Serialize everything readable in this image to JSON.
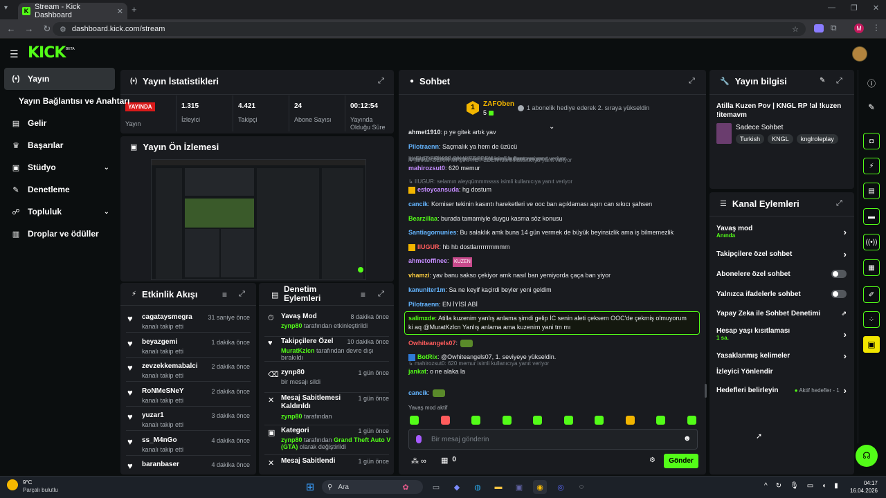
{
  "browser": {
    "tab_title": "Stream - Kick Dashboard",
    "url": "dashboard.kick.com/stream",
    "profile_initial": "M"
  },
  "brand": {
    "logo": "KICK",
    "badge": "BETA",
    "accent": "#53fc18"
  },
  "sidebar": {
    "items": [
      {
        "label": "Yayın",
        "icon": "broadcast-icon",
        "active": true
      },
      {
        "label": "Yayın Bağlantısı ve Anahtarı",
        "icon": "",
        "active": false
      },
      {
        "label": "Gelir",
        "icon": "revenue-icon",
        "active": false
      },
      {
        "label": "Başarılar",
        "icon": "trophy-icon",
        "active": false
      },
      {
        "label": "Stüdyo",
        "icon": "studio-icon",
        "active": false,
        "expandable": true
      },
      {
        "label": "Denetleme",
        "icon": "wrench-icon",
        "active": false
      },
      {
        "label": "Topluluk",
        "icon": "community-icon",
        "active": false,
        "expandable": true
      },
      {
        "label": "Droplar ve ödüller",
        "icon": "drops-icon",
        "active": false
      }
    ]
  },
  "stats": {
    "title": "Yayın İstatistikleri",
    "live_badge": "YAYINDA",
    "live_label": "Yayın",
    "items": [
      {
        "value": "1.315",
        "label": "İzleyici"
      },
      {
        "value": "4.421",
        "label": "Takipçi"
      },
      {
        "value": "24",
        "label": "Abone Sayısı"
      },
      {
        "value": "00:12:54",
        "label": "Yayında Olduğu Süre"
      }
    ]
  },
  "preview": {
    "title": "Yayın Ön İzlemesi"
  },
  "activity": {
    "title": "Etkinlik Akışı",
    "items": [
      {
        "user": "cagataysmegra",
        "action": "kanalı takip etti",
        "time": "31 saniye önce"
      },
      {
        "user": "beyazgemi",
        "action": "kanalı takip etti",
        "time": "1 dakika önce"
      },
      {
        "user": "zevzekkemabalci",
        "action": "kanalı takip etti",
        "time": "2 dakika önce"
      },
      {
        "user": "RoNMeSNeY",
        "action": "kanalı takip etti",
        "time": "2 dakika önce"
      },
      {
        "user": "yuzar1",
        "action": "kanalı takip etti",
        "time": "3 dakika önce"
      },
      {
        "user": "ss_M4nGo",
        "action": "kanalı takip etti",
        "time": "4 dakika önce"
      },
      {
        "user": "baranbaser",
        "action": "",
        "time": "4 dakika önce"
      }
    ]
  },
  "moderation": {
    "title": "Denetim Eylemleri",
    "items": [
      {
        "title": "Yavaş Mod",
        "user": "zynp80",
        "detail": "tarafından etkinleştirildi",
        "time": "8 dakika önce"
      },
      {
        "title": "Takipçilere Özel",
        "user": "MuratKzlcn",
        "detail": "tarafından devre dışı bırakıldı",
        "time": "10 dakika önce"
      },
      {
        "title": "zynp80",
        "user": "",
        "detail": "bir mesajı sildi",
        "time": "1 gün önce"
      },
      {
        "title": "Mesaj Sabitlemesi Kaldırıldı",
        "user": "zynp80",
        "detail": "tarafından",
        "time": "1 gün önce"
      },
      {
        "title": "Kategori",
        "user": "zynp80",
        "detail": "tarafından",
        "extra": "Grand Theft Auto V (GTA)",
        "extra2": "olarak değiştirildi",
        "time": "1 gün önce"
      },
      {
        "title": "Mesaj Sabitlendi",
        "user": "",
        "detail": "",
        "time": "1 gün önce"
      }
    ]
  },
  "chat": {
    "title": "Sohbet",
    "pinned_user": "ZAFOben",
    "pinned_count": "5",
    "pinned_text": "1 abonelik hediye ederek 2. sıraya yükseldin",
    "messages": [
      {
        "user": "ahmet1910",
        "text": ": p ye gitek artık yav",
        "color": "#e8eaed"
      },
      {
        "user": "Pilotraenn",
        "text": ": Saçmalık ya hem de üzücü",
        "color": "#64b5ff"
      },
      {
        "reply": "jankat: DERİN Mİ ŞİKAYET EDEN isimli kullanıcıya yanıt veriyor",
        "user": "mahirozsut0",
        "text": ": 620 memur",
        "color": "#c58dff"
      },
      {
        "reply": "IIUGUR: selamın aleyqümmmssss isimli kullanıcıya yanıt veriyor",
        "user": "estoycansuda",
        "text": ": hg dostum",
        "color": "#c58dff"
      },
      {
        "user": "cancik",
        "text": ": Komiser tekinin kasıntı hareketleri ve ooc ban açıklaması aşırı can sıkıcı şahsen",
        "color": "#64b5ff"
      },
      {
        "user": "Bearzillaa",
        "text": ": burada tamamiyle duygu kasma söz konusu",
        "color": "#53fc18"
      },
      {
        "user": "Santiagomunies",
        "text": ": Bu salaklık amk buna 14 gün vermek de büyük beyinsizlik ama iş bilmemezlik",
        "color": "#64b5ff"
      },
      {
        "user": "IIUGUR",
        "text": ": hb hb dostlarrrrrrmmmm",
        "color": "#ff5c5c"
      },
      {
        "user": "ahmetoffinee",
        "text": ": ",
        "emote": "KUZEN",
        "color": "#c58dff"
      },
      {
        "user": "vhamzi",
        "text": ": yav banu sakso çekiyor amk nasıl ban yemiyorda çaça ban yiyor",
        "color": "#ffcf40"
      },
      {
        "user": "kanuniter1m",
        "text": ": Sa ne keyif kaçirdi beyler yeni geldim",
        "color": "#64b5ff"
      },
      {
        "user": "Pilotraenn",
        "text": ": EN İYİSİ ABİ",
        "color": "#64b5ff"
      },
      {
        "user": "salimxde",
        "text": ": Atilla kuzenim yanlış anlama şimdi gelip İC senin aleti çeksem OOC'de çekmiş olmuyorum",
        "text2": "ki aq @MuratKzlcn Yanlış anlama ama kuzenim yani tm mı",
        "color": "#53fc18",
        "highlight": true
      },
      {
        "user": "Owhiteangels07",
        "text": ":",
        "color": "#ff5c5c"
      },
      {
        "user": "BotRix",
        "text": ": @Owhiteangels07, 1. seviyeye yükseldin.",
        "color": "#53fc18"
      },
      {
        "reply": "mahirozsut0: 620 memur isimli kullanıcıya yanıt veriyor",
        "user": "jankat",
        "text": ": o ne alaka la",
        "color": "#53fc18"
      },
      {
        "user": "cancik",
        "text": ":",
        "color": "#64b5ff"
      }
    ],
    "slow_mode_note": "Yavaş mod aktif",
    "input_placeholder": "Bir mesaj gönderin",
    "points": "0",
    "send_label": "Gönder"
  },
  "stream_info": {
    "title": "Yayın bilgisi",
    "stream_title": "Atilla Kuzen Pov | KNGL RP !al !kuzen !itemavm",
    "category": "Sadece Sohbet",
    "tags": [
      "Turkish",
      "KNGL",
      "knglroleplay"
    ]
  },
  "channel_actions": {
    "title": "Kanal Eylemleri",
    "items": [
      {
        "label": "Yavaş mod",
        "sub": "Anında",
        "control": "chevron"
      },
      {
        "label": "Takipçilere özel sohbet",
        "control": "chevron"
      },
      {
        "label": "Abonelere özel sohbet",
        "control": "toggle"
      },
      {
        "label": "Yalnızca ifadelerle sohbet",
        "control": "toggle"
      },
      {
        "label": "Yapay Zeka ile Sohbet Denetimi",
        "control": "external"
      },
      {
        "label": "Hesap yaşı kısıtlaması",
        "sub": "1 sa.",
        "control": "chevron"
      },
      {
        "label": "Yasaklanmış kelimeler",
        "control": "chevron"
      },
      {
        "label": "İzleyici Yönlendir",
        "control": "none"
      },
      {
        "label": "Hedefleri belirleyin",
        "control": "chevron",
        "status": "Aktif hedefler - 1"
      }
    ]
  },
  "taskbar": {
    "weather_temp": "9°C",
    "weather_text": "Parçalı bulutlu",
    "search_placeholder": "Ara",
    "time": "04:17",
    "date": "16.04.2026"
  }
}
